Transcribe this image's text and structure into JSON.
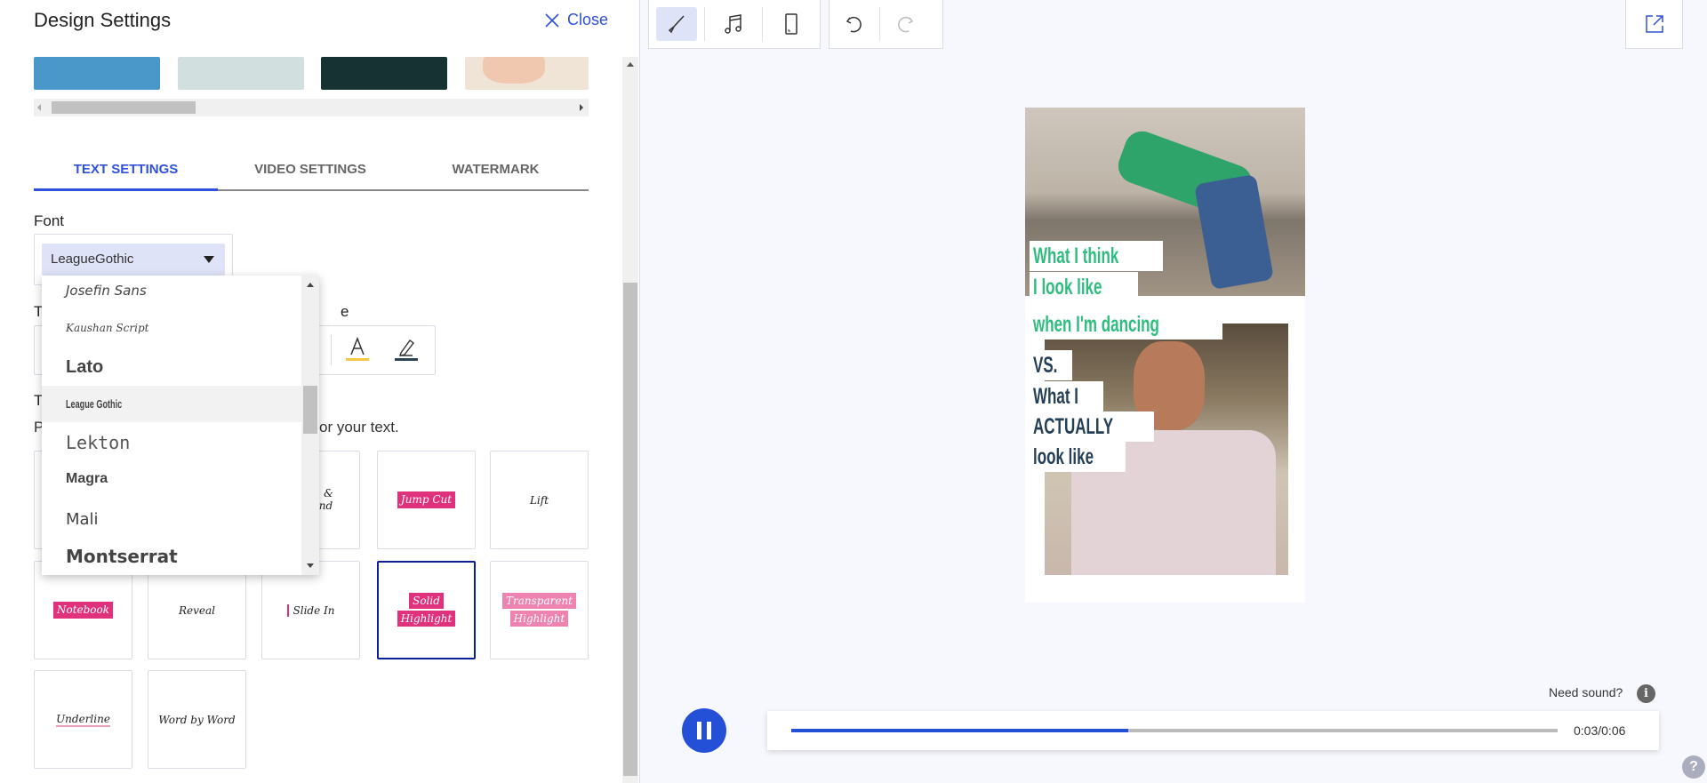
{
  "panel": {
    "title": "Design Settings",
    "close_label": "Close",
    "swatches": [
      "#4a97c9",
      "#d1e0df",
      "#173233",
      "#efe4d6"
    ],
    "tabs": [
      {
        "label": "TEXT SETTINGS",
        "active": true
      },
      {
        "label": "VIDEO SETTINGS",
        "active": false
      },
      {
        "label": "WATERMARK",
        "active": false
      }
    ],
    "font_label": "Font",
    "font_value": "LeagueGothic",
    "partial_label_1": "T",
    "partial_label_1_end": "e",
    "partial_label_2": "T",
    "partial_desc_start": "P",
    "partial_desc_end": "or your text.",
    "text_colors": {
      "font_color": "#f5c842",
      "highlight_color": "#2d4252"
    },
    "animations": [
      {
        "label": "&",
        "label2": "nd",
        "selected": false,
        "style": "plain"
      },
      {
        "label": "Jump Cut",
        "selected": false,
        "style": "pink"
      },
      {
        "label": "Lift",
        "selected": false,
        "style": "plain"
      },
      {
        "label": "Notebook",
        "selected": false,
        "style": "pink"
      },
      {
        "label": "Reveal",
        "selected": false,
        "style": "plain"
      },
      {
        "label": "Slide In",
        "selected": false,
        "style": "slide"
      },
      {
        "label": "Solid",
        "label2": "Highlight",
        "selected": true,
        "style": "pink"
      },
      {
        "label": "Transparent",
        "label2": "Highlight",
        "selected": false,
        "style": "pinklight"
      },
      {
        "label": "Underline",
        "selected": false,
        "style": "underline"
      },
      {
        "label": "Word by Word",
        "selected": false,
        "style": "plain"
      }
    ]
  },
  "font_dropdown": {
    "items": [
      "Josefin Sans",
      "Kaushan Script",
      "Lato",
      "League Gothic",
      "Lekton",
      "Magra",
      "Mali",
      "Montserrat"
    ],
    "highlighted": "League Gothic"
  },
  "toolbar": {
    "icons": [
      "brush-icon",
      "music-icon",
      "phone-frame-icon",
      "undo-icon",
      "redo-icon",
      "export-icon"
    ],
    "active": "brush-icon"
  },
  "preview": {
    "captions_green": [
      "What I think",
      "I look like",
      "when I'm dancing"
    ],
    "captions_navy": [
      "VS.",
      "What I",
      "ACTUALLY",
      "look like"
    ]
  },
  "player": {
    "state": "playing",
    "progress_percent": 44,
    "time": "0:03/0:06",
    "need_sound": "Need sound?",
    "accent": "#2450d8"
  }
}
